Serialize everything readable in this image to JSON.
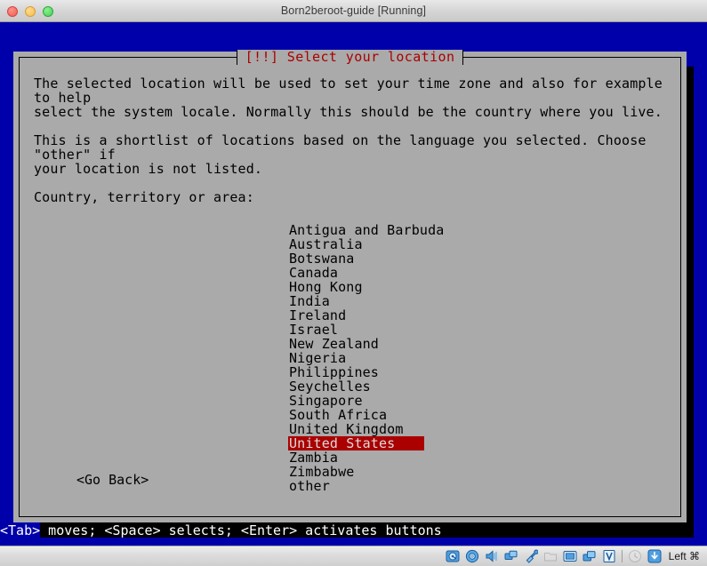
{
  "window": {
    "title": "Born2beroot-guide [Running]",
    "traffic_lights": [
      {
        "name": "close",
        "color": "#ee5f56"
      },
      {
        "name": "minimize",
        "color": "#f5bd4f"
      },
      {
        "name": "zoom",
        "color": "#46ce55"
      }
    ]
  },
  "colors": {
    "console_background": "#0000aa",
    "dialog_background": "#aaaaaa",
    "dialog_title_text": "#aa0000",
    "selection_background": "#aa0000",
    "selection_text": "#dcdcdc",
    "body_text": "#000000",
    "hint_text": "#ffffff"
  },
  "dialog": {
    "title": "[!!] Select your location",
    "paragraphs": [
      "The selected location will be used to set your time zone and also for example to help\nselect the system locale. Normally this should be the country where you live.",
      "This is a shortlist of locations based on the language you selected. Choose \"other\" if\nyour location is not listed."
    ],
    "prompt_label": "Country, territory or area:",
    "countries": [
      "Antigua and Barbuda",
      "Australia",
      "Botswana",
      "Canada",
      "Hong Kong",
      "India",
      "Ireland",
      "Israel",
      "New Zealand",
      "Nigeria",
      "Philippines",
      "Seychelles",
      "Singapore",
      "South Africa",
      "United Kingdom",
      "United States",
      "Zambia",
      "Zimbabwe",
      "other"
    ],
    "selected_country": "United States",
    "selected_index": 15,
    "buttons": {
      "go_back": "<Go Back>"
    }
  },
  "hint_bar": {
    "text": "<Tab> moves; <Space> selects; <Enter> activates buttons"
  },
  "statusbar": {
    "icons": [
      {
        "name": "hard-disk-icon",
        "title": "Hard Disks"
      },
      {
        "name": "optical-disk-icon",
        "title": "Optical Drives"
      },
      {
        "name": "audio-icon",
        "title": "Audio"
      },
      {
        "name": "network-icon",
        "title": "Network"
      },
      {
        "name": "usb-icon",
        "title": "USB Devices"
      },
      {
        "name": "shared-folder-icon",
        "title": "Shared Folders"
      },
      {
        "name": "display-icon",
        "title": "Display"
      },
      {
        "name": "video-capture-icon",
        "title": "Recording"
      },
      {
        "name": "virtualbox-logo-icon",
        "title": "VirtualBox Guest Additions"
      },
      {
        "name": "clock-icon",
        "title": "Recording disabled"
      },
      {
        "name": "host-key-indicator-icon",
        "title": "Host key"
      }
    ],
    "host_key_label": "Left ⌘"
  }
}
